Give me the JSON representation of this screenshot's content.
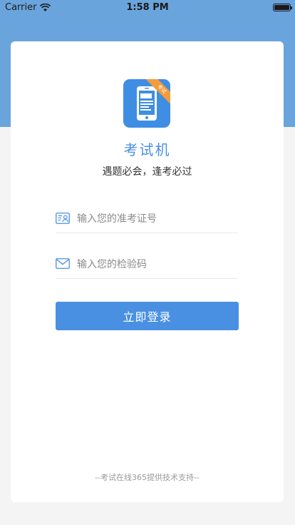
{
  "status_bar": {
    "carrier": "Carrier",
    "time": "1:58 PM",
    "wifi_icon": "wifi-icon",
    "battery_icon": "battery-icon"
  },
  "logo": {
    "icon": "phone-app-icon",
    "badge": "考试"
  },
  "app": {
    "title": "考试机",
    "slogan": "遇题必会，逢考必过"
  },
  "form": {
    "exam_id": {
      "icon": "id-card-icon",
      "value": "",
      "placeholder": "输入您的准考证号"
    },
    "code": {
      "icon": "envelope-icon",
      "value": "",
      "placeholder": "输入您的检验码"
    },
    "login_label": "立即登录"
  },
  "footer": "--考试在线365提供技术支持--",
  "colors": {
    "header": "#6aa4dc",
    "accent": "#4a90e2",
    "logo_bg": "#3f8ee3",
    "badge": "#f39c3c",
    "background": "#f4f4f4"
  }
}
